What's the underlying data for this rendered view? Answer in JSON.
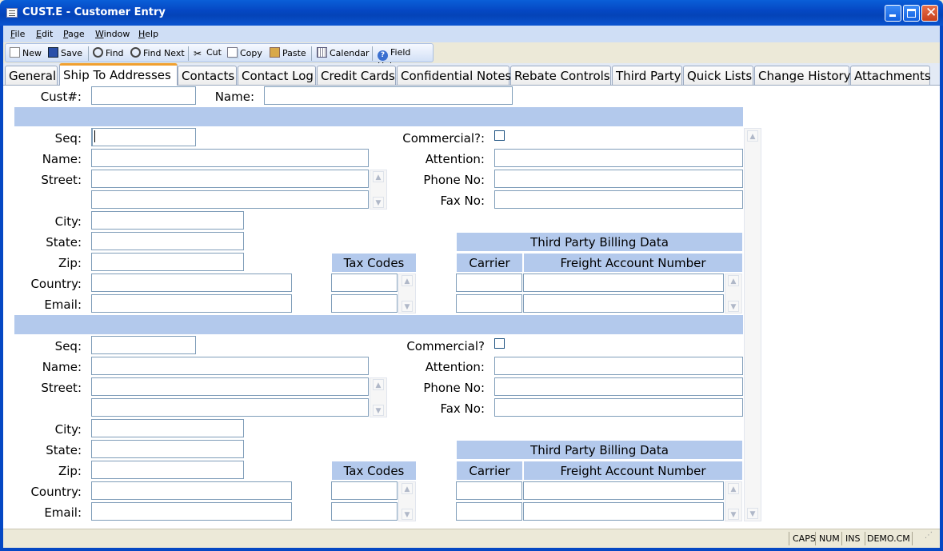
{
  "window": {
    "title": "CUST.E - Customer Entry"
  },
  "menu": [
    "File",
    "Edit",
    "Page",
    "Window",
    "Help"
  ],
  "toolbar": {
    "new": "New",
    "save": "Save",
    "find": "Find",
    "find_next": "Find Next",
    "cut": "Cut",
    "copy": "Copy",
    "paste": "Paste",
    "calendar": "Calendar",
    "field_help": "Field Help"
  },
  "tabs": [
    "General",
    "Ship To Addresses",
    "Contacts",
    "Contact Log",
    "Credit Cards",
    "Confidential Notes",
    "Rebate Controls",
    "Third Party",
    "Quick Lists",
    "Change History",
    "Attachments"
  ],
  "active_tab": "Ship To Addresses",
  "header": {
    "cust_label": "Cust#:",
    "cust_value": "",
    "name_label": "Name:",
    "name_value": ""
  },
  "addresses": [
    {
      "seq_label": "Seq:",
      "name_label": "Name:",
      "street_label": "Street:",
      "city_label": "City:",
      "state_label": "State:",
      "zip_label": "Zip:",
      "country_label": "Country:",
      "email_label": "Email:",
      "commercial_label": "Commercial?:",
      "attention_label": "Attention:",
      "phone_label": "Phone No:",
      "fax_label": "Fax No:",
      "tax_codes_header": "Tax Codes",
      "third_party_header": "Third Party Billing Data",
      "carrier_header": "Carrier",
      "freight_header": "Freight Account Number",
      "commercial_checked": false
    },
    {
      "seq_label": "Seq:",
      "name_label": "Name:",
      "street_label": "Street:",
      "city_label": "City:",
      "state_label": "State:",
      "zip_label": "Zip:",
      "country_label": "Country:",
      "email_label": "Email:",
      "commercial_label": "Commercial?",
      "attention_label": "Attention:",
      "phone_label": "Phone No:",
      "fax_label": "Fax No:",
      "tax_codes_header": "Tax Codes",
      "third_party_header": "Third Party Billing Data",
      "carrier_header": "Carrier",
      "freight_header": "Freight Account Number",
      "commercial_checked": false
    }
  ],
  "status": {
    "caps": "CAPS",
    "num": "NUM",
    "ins": "INS",
    "db": "DEMO.CM"
  }
}
